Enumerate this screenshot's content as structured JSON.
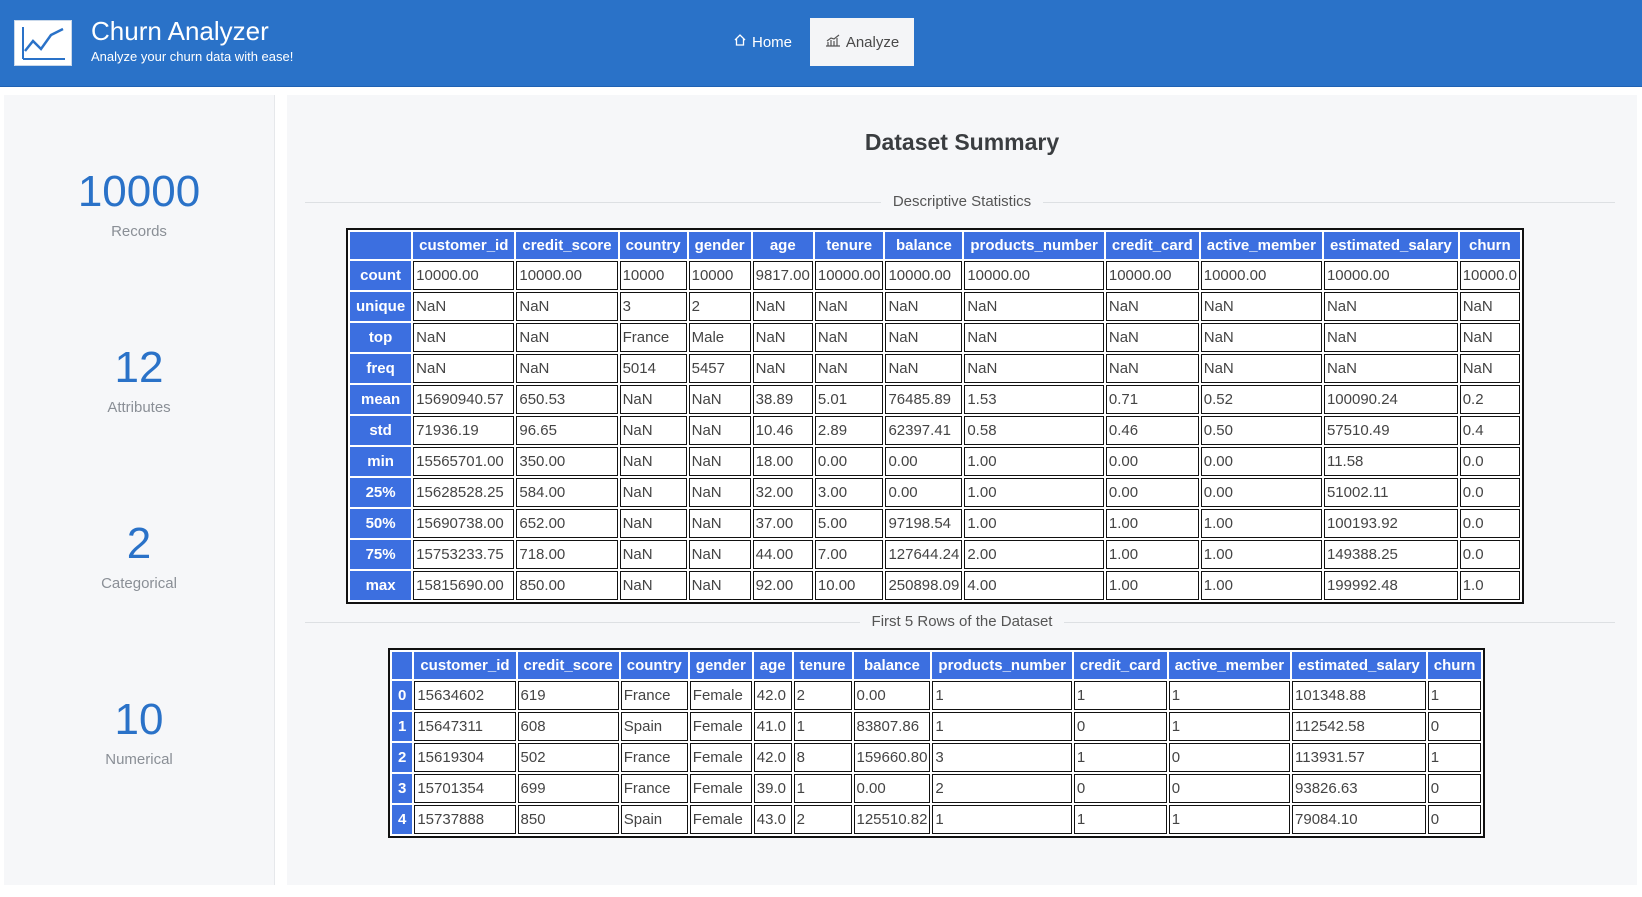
{
  "app": {
    "title": "Churn Analyzer",
    "subtitle": "Analyze your churn data with ease!",
    "logo_icon": "line-chart-icon"
  },
  "nav": {
    "home_label": "Home",
    "home_icon": "home-icon",
    "analyze_label": "Analyze",
    "analyze_icon": "bar-chart-icon",
    "active": "Analyze"
  },
  "stats": [
    {
      "value": "10000",
      "label": "Records"
    },
    {
      "value": "12",
      "label": "Attributes"
    },
    {
      "value": "2",
      "label": "Categorical"
    },
    {
      "value": "10",
      "label": "Numerical"
    }
  ],
  "summary": {
    "title": "Dataset Summary",
    "descriptive_label": "Descriptive Statistics",
    "first_rows_label": "First 5 Rows of the Dataset"
  },
  "describe_table": {
    "columns": [
      "customer_id",
      "credit_score",
      "country",
      "gender",
      "age",
      "tenure",
      "balance",
      "products_number",
      "credit_card",
      "active_member",
      "estimated_salary",
      "churn"
    ],
    "rows": [
      {
        "index": "count",
        "cells": [
          "10000.00",
          "10000.00",
          "10000",
          "10000",
          "9817.00",
          "10000.00",
          "10000.00",
          "10000.00",
          "10000.00",
          "10000.00",
          "10000.00",
          "10000.0"
        ]
      },
      {
        "index": "unique",
        "cells": [
          "NaN",
          "NaN",
          "3",
          "2",
          "NaN",
          "NaN",
          "NaN",
          "NaN",
          "NaN",
          "NaN",
          "NaN",
          "NaN"
        ]
      },
      {
        "index": "top",
        "cells": [
          "NaN",
          "NaN",
          "France",
          "Male",
          "NaN",
          "NaN",
          "NaN",
          "NaN",
          "NaN",
          "NaN",
          "NaN",
          "NaN"
        ]
      },
      {
        "index": "freq",
        "cells": [
          "NaN",
          "NaN",
          "5014",
          "5457",
          "NaN",
          "NaN",
          "NaN",
          "NaN",
          "NaN",
          "NaN",
          "NaN",
          "NaN"
        ]
      },
      {
        "index": "mean",
        "cells": [
          "15690940.57",
          "650.53",
          "NaN",
          "NaN",
          "38.89",
          "5.01",
          "76485.89",
          "1.53",
          "0.71",
          "0.52",
          "100090.24",
          "0.2"
        ]
      },
      {
        "index": "std",
        "cells": [
          "71936.19",
          "96.65",
          "NaN",
          "NaN",
          "10.46",
          "2.89",
          "62397.41",
          "0.58",
          "0.46",
          "0.50",
          "57510.49",
          "0.4"
        ]
      },
      {
        "index": "min",
        "cells": [
          "15565701.00",
          "350.00",
          "NaN",
          "NaN",
          "18.00",
          "0.00",
          "0.00",
          "1.00",
          "0.00",
          "0.00",
          "11.58",
          "0.0"
        ]
      },
      {
        "index": "25%",
        "cells": [
          "15628528.25",
          "584.00",
          "NaN",
          "NaN",
          "32.00",
          "3.00",
          "0.00",
          "1.00",
          "0.00",
          "0.00",
          "51002.11",
          "0.0"
        ]
      },
      {
        "index": "50%",
        "cells": [
          "15690738.00",
          "652.00",
          "NaN",
          "NaN",
          "37.00",
          "5.00",
          "97198.54",
          "1.00",
          "1.00",
          "1.00",
          "100193.92",
          "0.0"
        ]
      },
      {
        "index": "75%",
        "cells": [
          "15753233.75",
          "718.00",
          "NaN",
          "NaN",
          "44.00",
          "7.00",
          "127644.24",
          "2.00",
          "1.00",
          "1.00",
          "149388.25",
          "0.0"
        ]
      },
      {
        "index": "max",
        "cells": [
          "15815690.00",
          "850.00",
          "NaN",
          "NaN",
          "92.00",
          "10.00",
          "250898.09",
          "4.00",
          "1.00",
          "1.00",
          "199992.48",
          "1.0"
        ]
      }
    ]
  },
  "head_table": {
    "columns": [
      "customer_id",
      "credit_score",
      "country",
      "gender",
      "age",
      "tenure",
      "balance",
      "products_number",
      "credit_card",
      "active_member",
      "estimated_salary",
      "churn"
    ],
    "rows": [
      {
        "index": "0",
        "cells": [
          "15634602",
          "619",
          "France",
          "Female",
          "42.0",
          "2",
          "0.00",
          "1",
          "1",
          "1",
          "101348.88",
          "1"
        ]
      },
      {
        "index": "1",
        "cells": [
          "15647311",
          "608",
          "Spain",
          "Female",
          "41.0",
          "1",
          "83807.86",
          "1",
          "0",
          "1",
          "112542.58",
          "0"
        ]
      },
      {
        "index": "2",
        "cells": [
          "15619304",
          "502",
          "France",
          "Female",
          "42.0",
          "8",
          "159660.80",
          "3",
          "1",
          "0",
          "113931.57",
          "1"
        ]
      },
      {
        "index": "3",
        "cells": [
          "15701354",
          "699",
          "France",
          "Female",
          "39.0",
          "1",
          "0.00",
          "2",
          "0",
          "0",
          "93826.63",
          "0"
        ]
      },
      {
        "index": "4",
        "cells": [
          "15737888",
          "850",
          "Spain",
          "Female",
          "43.0",
          "2",
          "125510.82",
          "1",
          "1",
          "1",
          "79084.10",
          "0"
        ]
      }
    ]
  },
  "colors": {
    "brand": "#2a72c8",
    "table_header": "#3c6fe0"
  }
}
